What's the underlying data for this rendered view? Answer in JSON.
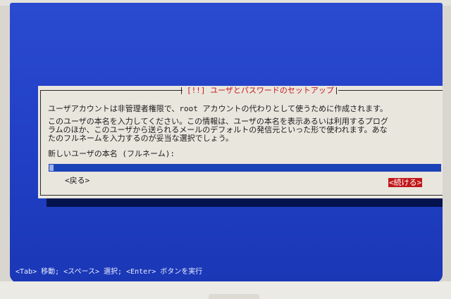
{
  "dialog": {
    "title": "[!!] ユーザとパスワードのセットアップ",
    "intro_line": "ユーザアカウントは非管理者権限で、root アカウントの代わりとして使うために作成されます。",
    "description_lines": [
      "このユーザの本名を入力してください。この情報は、ユーザの本名を表示あるいは利用するプログ",
      "ラムのほか、このユーザから送られるメールのデフォルトの発信元といった形で使われます。あな",
      "たのフルネームを入力するのが妥当な選択でしょう。"
    ],
    "field_label": "新しいユーザの本名 (フルネーム):",
    "field_value": "",
    "back_label": "<戻る>",
    "continue_label": "<続ける>"
  },
  "helpbar": {
    "text": "<Tab> 移動; <スペース> 選択; <Enter> ボタンを実行"
  },
  "colors": {
    "screen_blue": "#2140c6",
    "dialog_bg": "#e9e6de",
    "title_red": "#c41818",
    "button_selected_bg": "#c0171a",
    "field_blue": "#1b43b8"
  }
}
